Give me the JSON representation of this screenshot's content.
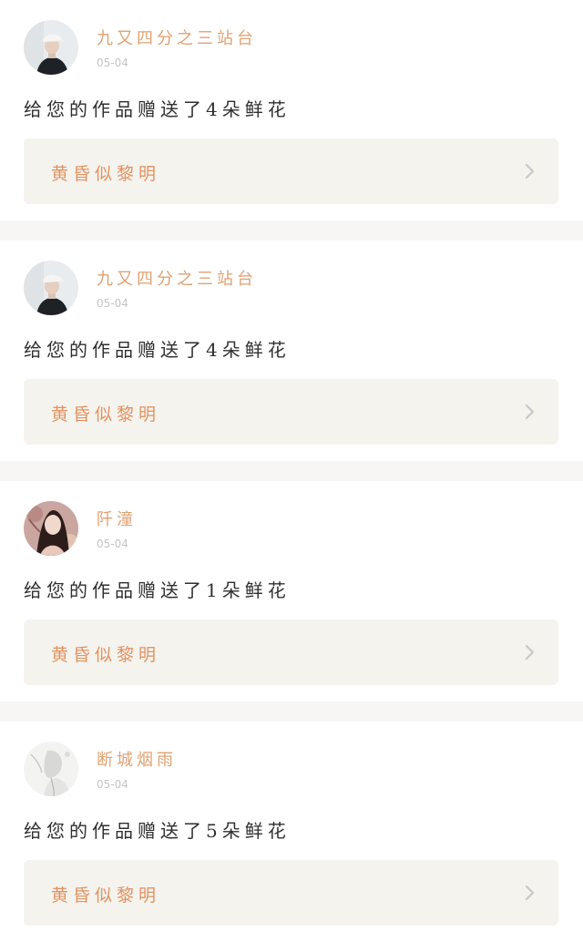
{
  "notifications": [
    {
      "username": "九又四分之三站台",
      "date": "05-04",
      "message": "给您的作品赠送了4朵鲜花",
      "work_title": "黄昏似黎明",
      "avatar_icon": "avatar-man-cap-icon"
    },
    {
      "username": "九又四分之三站台",
      "date": "05-04",
      "message": "给您的作品赠送了4朵鲜花",
      "work_title": "黄昏似黎明",
      "avatar_icon": "avatar-man-cap-icon"
    },
    {
      "username": "阡潼",
      "date": "05-04",
      "message": "给您的作品赠送了1朵鲜花",
      "work_title": "黄昏似黎明",
      "avatar_icon": "avatar-woman-icon"
    },
    {
      "username": "断城烟雨",
      "date": "05-04",
      "message": "给您的作品赠送了5朵鲜花",
      "work_title": "黄昏似黎明",
      "avatar_icon": "avatar-ink-figure-icon"
    }
  ],
  "colors": {
    "username": "#e0a273",
    "work_title": "#e29361",
    "link_background": "#f4f3ee",
    "separator": "#f7f6f4",
    "date": "#c4c4c4",
    "chevron": "#c8c8c8"
  }
}
